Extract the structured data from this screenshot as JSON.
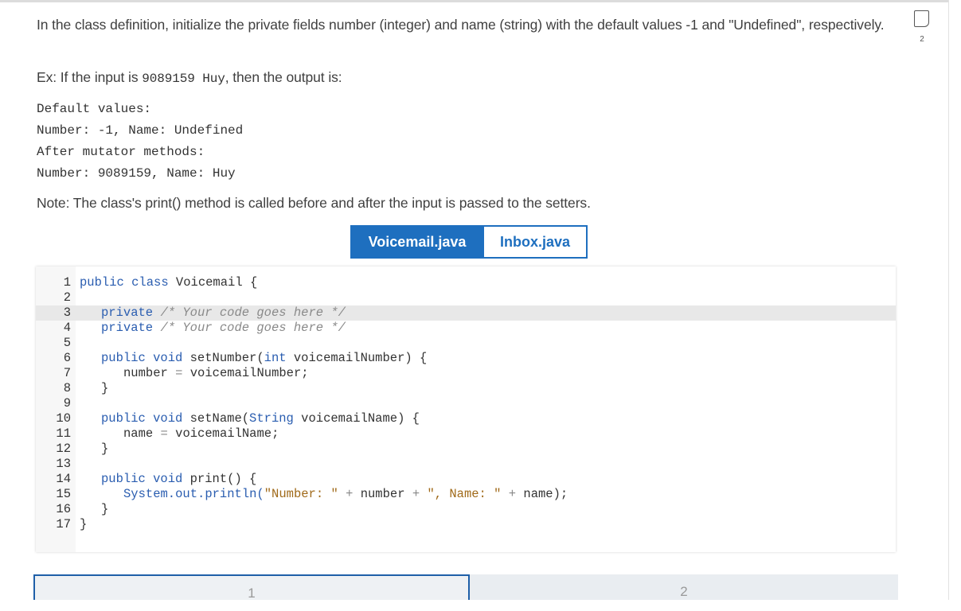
{
  "prompt": {
    "para1": "In the class definition, initialize the private fields number (integer) and name (string) with the default values -1 and \"Undefined\", respectively.",
    "example_prefix": "Ex: If the input is ",
    "example_input": "9089159 Huy",
    "example_suffix": ", then the output is:",
    "output_lines": [
      "Default values:",
      "Number: -1, Name: Undefined",
      "After mutator methods:",
      "Number: 9089159, Name: Huy"
    ],
    "note": "Note: The class's print() method is called before and after the input is passed to the setters."
  },
  "flag": {
    "count": "2"
  },
  "tabs": [
    {
      "label": "Voicemail.java",
      "active": true
    },
    {
      "label": "Inbox.java",
      "active": false
    }
  ],
  "code": {
    "line_numbers": [
      "1",
      "2",
      "3",
      "4",
      "5",
      "6",
      "7",
      "8",
      "9",
      "10",
      "11",
      "12",
      "13",
      "14",
      "15",
      "16",
      "17"
    ],
    "l1_kw": "public class",
    "l1_rest": " Voicemail {",
    "l3_kw": "private",
    "l3_cm": "/* Your code goes here */",
    "l4_kw": "private",
    "l4_cm": "/* Your code goes here */",
    "l6_kw": "public void",
    "l6_fn": " setNumber(",
    "l6_ty": "int",
    "l6_rest": " voicemailNumber) {",
    "l7_a": "number",
    "l7_op": "=",
    "l7_b": "voicemailNumber;",
    "l8": "}",
    "l10_kw": "public void",
    "l10_fn": " setName(",
    "l10_ty": "String",
    "l10_rest": " voicemailName) {",
    "l11_a": "name",
    "l11_op": "=",
    "l11_b": "voicemailName;",
    "l12": "}",
    "l14_kw": "public void",
    "l14_rest": " print() {",
    "l15_call": "System.out.println(",
    "l15_s1": "\"Number: \"",
    "l15_op1": "+",
    "l15_v1": "number",
    "l15_op2": "+",
    "l15_s2": "\", Name: \"",
    "l15_op3": "+",
    "l15_end": "name);",
    "l16": "}",
    "l17": "}"
  },
  "levels": [
    {
      "label": "1",
      "active": true
    },
    {
      "label": "2",
      "active": false
    }
  ],
  "colors": {
    "accent": "#1e6fbf",
    "keyword": "#2a5db0",
    "comment": "#8a8a8a",
    "string": "#a06a1a"
  }
}
